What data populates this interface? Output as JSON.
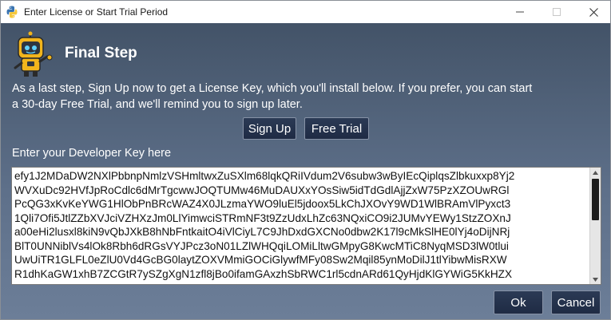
{
  "window": {
    "title": "Enter License or Start Trial Period"
  },
  "header": {
    "heading": "Final Step",
    "description": "As a last step, Sign Up now to get a License Key, which you'll install below. If you prefer, you can start\na 30-day Free Trial, and we'll remind you to sign up later."
  },
  "actions": {
    "signup_label": "Sign Up",
    "trial_label": "Free Trial"
  },
  "key_section": {
    "label": "Enter your Developer Key here",
    "value": "efy1J2MDaDW2NXlPbbnpNmlzVSHmltwxZuSXlm68lqkQRiIVdum2V6subw3wByIEcQiplqsZlbkuxxp8Yj2\nWVXuDc92HVfJpRoCdlc6dMrTgcwwJOQTUMw46MuDAUXxYOsSiw5idTdGdlAjjZxW75PzXZOUwRGl\nPcQG3xKvKeYWG1HlObPnBRcWAZ4X0JLzmaYWO9luEl5jdoox5LkChJXOvY9WD1WlBRAmVlPyxct3\n1Qli7Ofi5JtlZZbXVJciVZHXzJm0LlYimwciSTRmNF3t9ZzUdxLhZc63NQxiCO9i2JUMvYEWy1StzZOXnJ\na00eHi2lusxl8kiN9vQbJXkB8hNbFntkaitO4iVlCiyL7C9JhDxdGXCNo0dbw2K17l9cMkSlHE0lYj4oDijNRj\nBlT0UNNiblVs4lOk8Rbh6dRGsVYJPcz3oN01LZlWHQqiLOMiLltwGMpyG8KwcMTiC8NyqMSD3lW0tlui\nUwUiTR1GLFL0eZlU0Vd4GcBG0laytZOXVMmiGOCiGlywfMFy08Sw2Mqil85ynMoDilJ1tlYibwMisRXW\nR1dhKaGW1xhB7ZCGtR7ySZgXgN1zfl8jBo0ifamGAxzhSbRWC1rl5cdnARd61QyHjdKlGYWiG5KkHZX"
  },
  "footer": {
    "ok_label": "Ok",
    "cancel_label": "Cancel"
  },
  "icons": {
    "app": "python-logo-icon",
    "mascot": "robot-mascot-icon"
  },
  "colors": {
    "background_top": "#3f4f63",
    "background_bottom": "#6c7e98",
    "button_bg": "#1f2b44",
    "button_border": "#8792a6",
    "text": "#ffffff"
  }
}
